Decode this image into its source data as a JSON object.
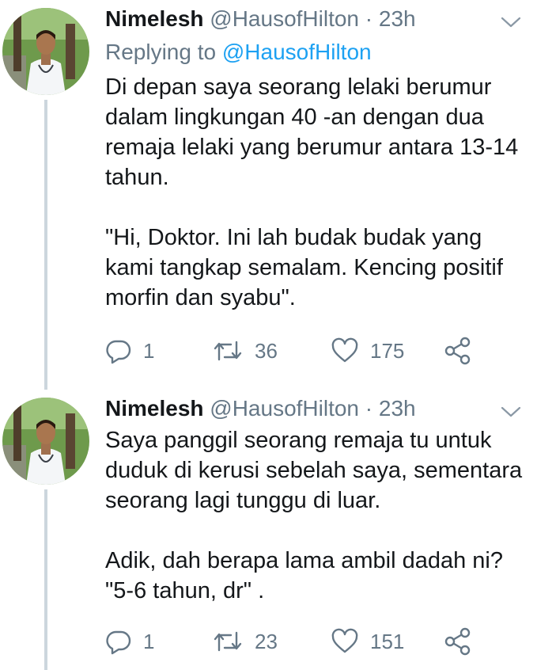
{
  "tweets": [
    {
      "author_name": "Nimelesh",
      "author_handle": "@HausofHilton",
      "separator": "·",
      "time": "23h",
      "replying_prefix": "Replying to",
      "replying_mention": "@HausofHilton",
      "paragraphs": [
        "Di depan saya seorang lelaki berumur dalam lingkungan 40 -an dengan dua remaja lelaki yang berumur antara 13-14 tahun.",
        "\"Hi, Doktor. Ini lah budak budak yang kami tangkap semalam. Kencing positif morfin dan syabu\"."
      ],
      "replies": "1",
      "retweets": "36",
      "likes": "175"
    },
    {
      "author_name": "Nimelesh",
      "author_handle": "@HausofHilton",
      "separator": "·",
      "time": "23h",
      "paragraphs": [
        "Saya panggil seorang remaja tu untuk duduk di kerusi sebelah saya, sementara seorang lagi tunggu di luar.",
        "Adik, dah berapa lama ambil dadah ni? \"5-6 tahun, dr\" ."
      ],
      "replies": "1",
      "retweets": "23",
      "likes": "151"
    }
  ],
  "icons": {
    "reply": "reply-icon",
    "retweet": "retweet-icon",
    "like": "heart-icon",
    "share": "share-icon",
    "menu": "chevron-down-icon"
  },
  "colors": {
    "text": "#14171a",
    "secondary": "#657786",
    "link": "#1da1f2",
    "thread_line": "#ccd6dd"
  }
}
